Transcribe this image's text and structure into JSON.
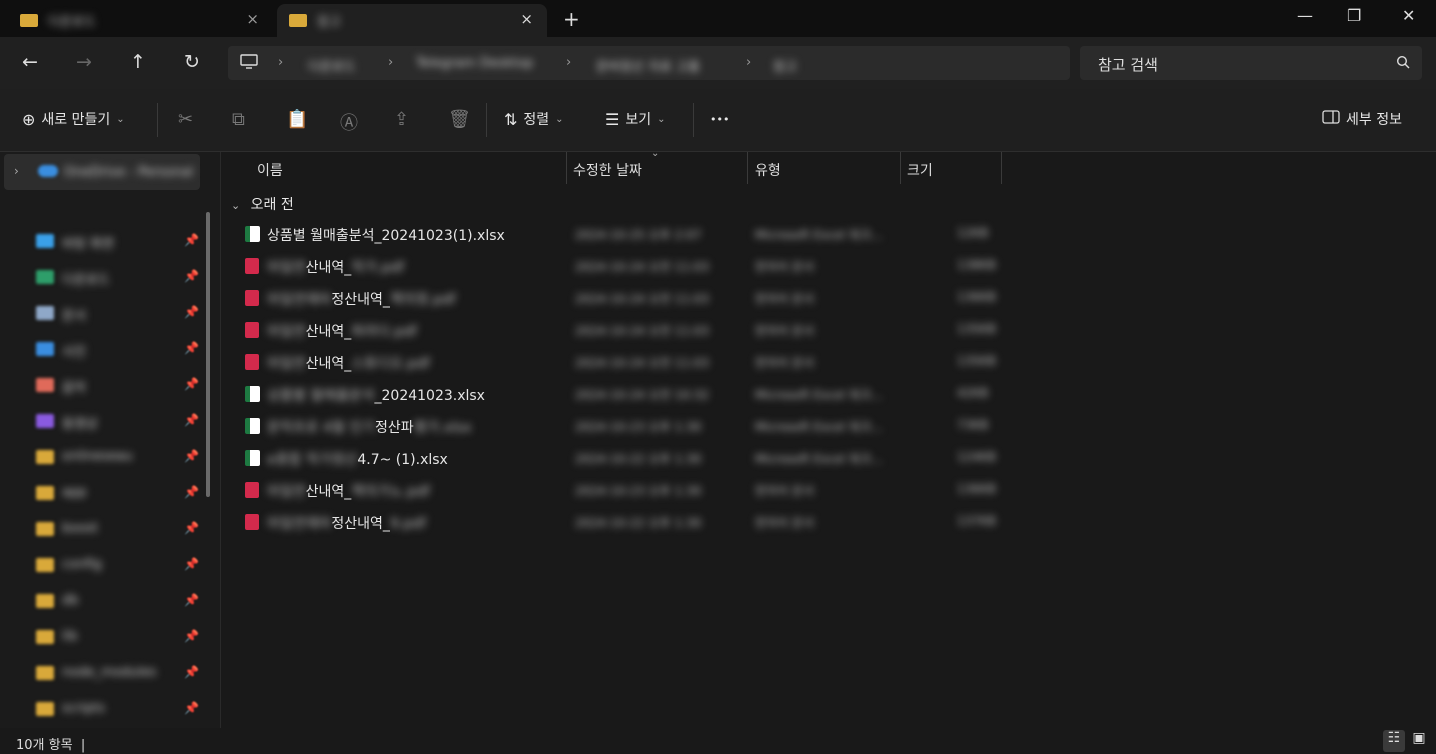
{
  "tabs": [
    {
      "name": "다운로드",
      "close": "×"
    },
    {
      "name": "참고",
      "close": "×"
    }
  ],
  "new_tab_icon": "+",
  "window_controls": [
    "—",
    "❐",
    "✕"
  ],
  "address": {
    "crumbs": [
      "다운로드",
      "Telegram Desktop",
      "문버정산 자료 고품",
      "참고"
    ]
  },
  "search": {
    "placeholder": "참고 검색"
  },
  "toolbar": {
    "new_label": "새로 만들기",
    "sort_label": "정렬",
    "view_label": "보기",
    "details_label": "세부 정보",
    "more": "•••"
  },
  "sidebar": {
    "onedrive": "OneDrive - Personal",
    "items": [
      {
        "label": "바탕 화면",
        "color": "#3aa0e8"
      },
      {
        "label": "다운로드",
        "color": "#2e9e6a"
      },
      {
        "label": "문서",
        "color": "#8fa8c8"
      },
      {
        "label": "사진",
        "color": "#3a8ee0"
      },
      {
        "label": "음악",
        "color": "#e06a5a"
      },
      {
        "label": "동영상",
        "color": "#8a5ae0"
      },
      {
        "label": "onlineseau",
        "color": "#d9a93a"
      },
      {
        "label": "app",
        "color": "#d9a93a"
      },
      {
        "label": "boost",
        "color": "#d9a93a"
      },
      {
        "label": "config",
        "color": "#d9a93a"
      },
      {
        "label": "db",
        "color": "#d9a93a"
      },
      {
        "label": "lib",
        "color": "#d9a93a"
      },
      {
        "label": "node_modules",
        "color": "#d9a93a"
      },
      {
        "label": "scripts",
        "color": "#d9a93a"
      }
    ]
  },
  "columns": {
    "name": "이름",
    "date": "수정한 날짜",
    "type": "유형",
    "size": "크기"
  },
  "group_label": "오래 전",
  "files": [
    {
      "type": "xlsx",
      "name": "상품별 월매출분석_20241023(1).xlsx",
      "date": "2024-10-25 오후 2:07",
      "kind": "Microsoft Excel 워크...",
      "size": "12KB"
    },
    {
      "type": "pdf",
      "name_blur": "마일연",
      "name": "산내역_",
      "name_tail": "작가.pdf",
      "date": "2024-10-24 오전 11:03",
      "kind": "한자어 문서",
      "size": "138KB"
    },
    {
      "type": "pdf",
      "name_blur": "마일연재마",
      "name": "정산내역_",
      "name_tail": "책의정.pdf",
      "date": "2024-10-24 오전 11:03",
      "kind": "한자어 문서",
      "size": "136KB"
    },
    {
      "type": "pdf",
      "name_blur": "마일연",
      "name": "산내역_",
      "name_tail": "파라다.pdf",
      "date": "2024-10-24 오전 11:03",
      "kind": "한자어 문서",
      "size": "135KB"
    },
    {
      "type": "pdf",
      "name_blur": "마일연",
      "name": "산내역_",
      "name_tail": "스튜디오.pdf",
      "date": "2024-10-24 오전 11:03",
      "kind": "한자어 문서",
      "size": "135KB"
    },
    {
      "type": "xlsx",
      "name_blur": "상품별 월매출분석",
      "name": "_20241023.xlsx",
      "date": "2024-10-24 오전 10:32",
      "kind": "Microsoft Excel 워크...",
      "size": "42KB"
    },
    {
      "type": "xlsx",
      "name_blur": "문작프로 4월 인기",
      "name": "정산파",
      "name_tail": "평가.xlsx",
      "date": "2024-10-23 오후 1:30",
      "kind": "Microsoft Excel 워크...",
      "size": "73KB"
    },
    {
      "type": "xlsx",
      "name_blur": "e종합 작가정산",
      "name": "4.7~ (1).xlsx",
      "date": "2024-10-22 오후 1:30",
      "kind": "Microsoft Excel 워크...",
      "size": "124KB"
    },
    {
      "type": "pdf",
      "name_blur": "마일연",
      "name": "산내역_",
      "name_tail": "책의가노.pdf",
      "date": "2024-10-23 오후 1:30",
      "kind": "한자어 문서",
      "size": "136KB"
    },
    {
      "type": "pdf",
      "name_blur": "마일연재마",
      "name": "정산내역_",
      "name_tail": "9.pdf",
      "date": "2024-10-22 오후 1:30",
      "kind": "한자어 문서",
      "size": "137KB"
    }
  ],
  "status": {
    "count": "10개 항목"
  }
}
